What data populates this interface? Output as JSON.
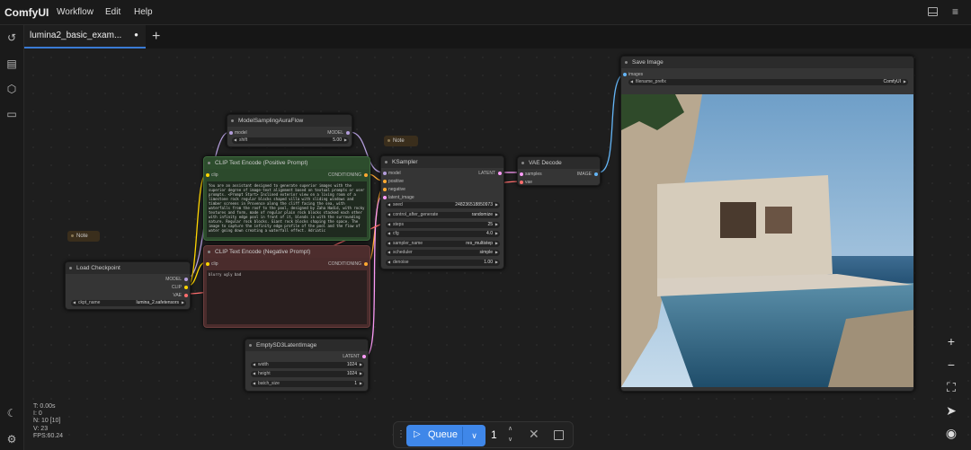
{
  "app": {
    "title": "ComfyUI"
  },
  "menu": {
    "items": [
      "Workflow",
      "Edit",
      "Help"
    ]
  },
  "tab": {
    "label": "lumina2_basic_exam...",
    "modified_dot": "●"
  },
  "nodes": {
    "model_sampling": {
      "title": "ModelSamplingAuraFlow",
      "in_model": "model",
      "out_model": "MODEL",
      "shift_label": "shift",
      "shift_value": "5.00"
    },
    "clip_pos": {
      "title": "CLIP Text Encode (Positive Prompt)",
      "in_clip": "clip",
      "out": "CONDITIONING",
      "text": "You are an assistant designed to generate superior images with the superior degree of image-text alignment based on textual prompts or user prompts. <Prompt Start> Inclined exterior view on a living room of a limestone rock regular blocks shaped villa with sliding windows and timber screens in Provence along the cliff facing the sea, with waterfalls from the roof to the pool, designed by Zaha Hadid, with rocky textures and form, made of regular plain rock blocks stacked each other with infinity edge pool in front of it, blends in with the surrounding nature. Regular rock blocks. Giant rock blocks shaping the space. The image to capture the infinity edge profile of the pool and the flow of water going down creating a waterfall effect. Adriatic"
    },
    "clip_neg": {
      "title": "CLIP Text Encode (Negative Prompt)",
      "in_clip": "clip",
      "out": "CONDITIONING",
      "text": "blurry ugly bad"
    },
    "note1": {
      "title": "Note"
    },
    "note2": {
      "title": "Note"
    },
    "ksampler": {
      "title": "KSampler",
      "out": "LATENT",
      "inputs": [
        "model",
        "positive",
        "negative",
        "latent_image"
      ],
      "widgets": [
        {
          "label": "seed",
          "value": "248236518850973"
        },
        {
          "label": "control_after_generate",
          "value": "randomize"
        },
        {
          "label": "steps",
          "value": "25"
        },
        {
          "label": "cfg",
          "value": "4.0"
        },
        {
          "label": "sampler_name",
          "value": "res_multistep"
        },
        {
          "label": "scheduler",
          "value": "simple"
        },
        {
          "label": "denoise",
          "value": "1.00"
        }
      ]
    },
    "vae_decode": {
      "title": "VAE Decode",
      "in_samples": "samples",
      "in_vae": "vae",
      "out": "IMAGE"
    },
    "save_image": {
      "title": "Save Image",
      "in_images": "images",
      "prefix_label": "filename_prefix",
      "prefix_value": "ComfyUI"
    },
    "load_checkpoint": {
      "title": "Load Checkpoint",
      "out_model": "MODEL",
      "out_clip": "CLIP",
      "out_vae": "VAE",
      "ckpt_label": "ckpt_name",
      "ckpt_value": "lumina_2.safetensors"
    },
    "empty_latent": {
      "title": "EmptySD3LatentImage",
      "out": "LATENT",
      "widgets": [
        {
          "label": "width",
          "value": "1024"
        },
        {
          "label": "height",
          "value": "1024"
        },
        {
          "label": "batch_size",
          "value": "1"
        }
      ]
    }
  },
  "queue": {
    "label": "Queue",
    "count": "1"
  },
  "stats": [
    "T: 0.00s",
    "I: 0",
    "N: 10 [10]",
    "V: 23",
    "FPS:60.24"
  ],
  "colors": {
    "accent": "#3f87e9",
    "model": "#b39ddb",
    "clip": "#ffd500",
    "vae": "#ff6e6e",
    "conditioning": "#ffa931",
    "latent": "#ff9cf9",
    "image": "#64b5f6"
  }
}
